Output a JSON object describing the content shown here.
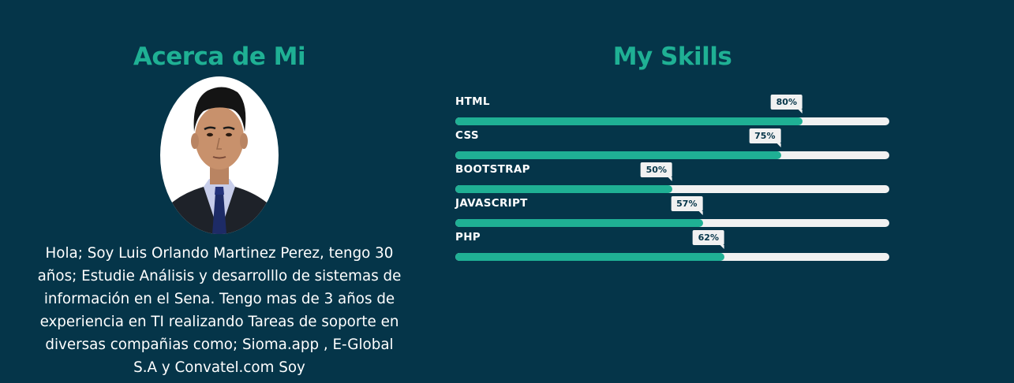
{
  "about": {
    "title": "Acerca de Mi",
    "text": "Hola; Soy Luis Orlando Martinez Perez, tengo 30 años; Estudie Análisis y desarrolllo de sistemas de información en el Sena. Tengo mas de 3 años de experiencia en TI realizando Tareas de soporte en diversas compañias como; Sioma.app , E-Global S.A y Convatel.com Soy"
  },
  "skills": {
    "title": "My Skills",
    "items": [
      {
        "name": "HTML",
        "percent": 80,
        "label": "80%"
      },
      {
        "name": "CSS",
        "percent": 75,
        "label": "75%"
      },
      {
        "name": "BOOTSTRAP",
        "percent": 50,
        "label": "50%"
      },
      {
        "name": "JAVASCRIPT",
        "percent": 57,
        "label": "57%"
      },
      {
        "name": "PHP",
        "percent": 62,
        "label": "62%"
      }
    ]
  },
  "colors": {
    "background": "#053549",
    "accent": "#1fb094",
    "track": "#f1f1f1"
  }
}
